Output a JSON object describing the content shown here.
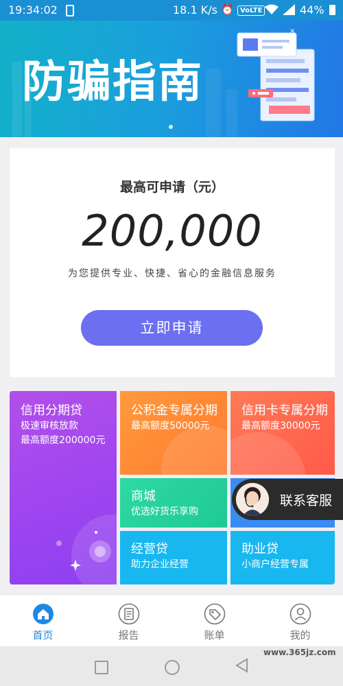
{
  "status_bar": {
    "time": "19:34:02",
    "speed": "18.1 K/s",
    "volte": "VoLTE",
    "battery": "44%"
  },
  "banner": {
    "title": "防骗指南"
  },
  "apply": {
    "label": "最高可申请（元）",
    "amount": "200,000",
    "subtitle": "为您提供专业、快捷、省心的金融信息服务",
    "button": "立即申请",
    "button_color": "#6b6ff0"
  },
  "products": {
    "credit": {
      "title": "信用分期贷",
      "line1": "极速审核放款",
      "line2": "最高额度200000元"
    },
    "fund": {
      "title": "公积金专属分期",
      "line1": "最高额度50000元"
    },
    "card": {
      "title": "信用卡专属分期",
      "line1": "最高额度30000元"
    },
    "mall": {
      "title": "商城",
      "line1": "优选好货乐享购"
    },
    "biz": {
      "title": "经营贷",
      "line1": "助力企业经营"
    },
    "job": {
      "title": "助业贷",
      "line1": "小商户经营专属"
    }
  },
  "customer_service": {
    "label": "联系客服"
  },
  "bottom_nav": {
    "items": [
      {
        "label": "首页",
        "icon": "home-icon",
        "active": true
      },
      {
        "label": "报告",
        "icon": "report-icon",
        "active": false
      },
      {
        "label": "账单",
        "icon": "bill-tag-icon",
        "active": false
      },
      {
        "label": "我的",
        "icon": "profile-icon",
        "active": false
      }
    ],
    "active_color": "#1e88e5"
  },
  "watermark": "www.365jz.com"
}
